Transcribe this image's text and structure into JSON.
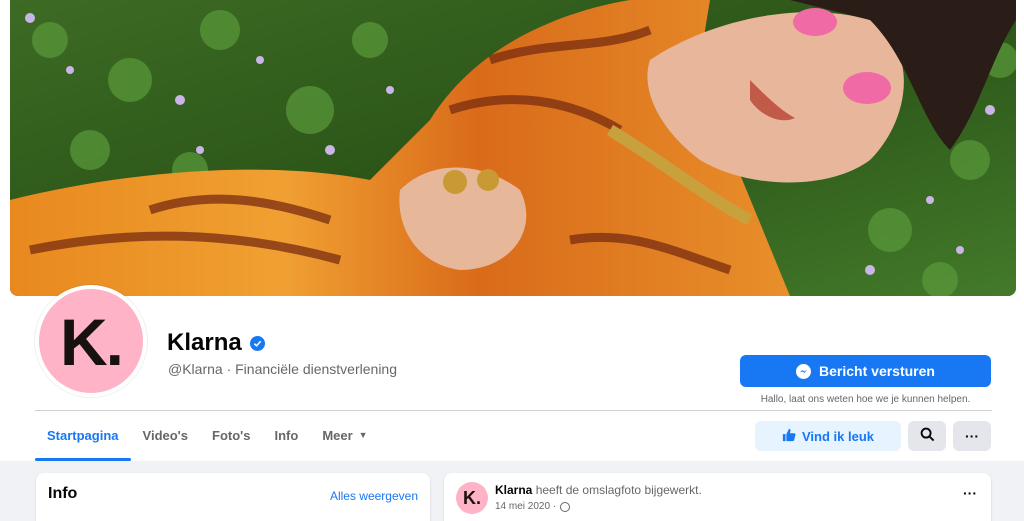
{
  "page": {
    "name": "Klarna",
    "subtitle": "@Klarna · Financiële dienstverlening",
    "avatar_mark": "K.",
    "verified_icon": "verified-badge-icon"
  },
  "actions": {
    "message_label": "Bericht versturen",
    "message_hint": "Hallo, laat ons weten hoe we je kunnen helpen.",
    "like_label": "Vind ik leuk",
    "search_icon": "search-icon",
    "more_icon": "more-dots-icon",
    "more_glyph": "···"
  },
  "tabs": [
    {
      "label": "Startpagina",
      "active": true
    },
    {
      "label": "Video's"
    },
    {
      "label": "Foto's"
    },
    {
      "label": "Info"
    },
    {
      "label": "Meer"
    }
  ],
  "info_card": {
    "title": "Info",
    "link": "Alles weergeven"
  },
  "post": {
    "author": "Klarna",
    "action": "heeft de omslagfoto bijgewerkt.",
    "date": "14 mei 2020 ·",
    "avatar_mark": "K."
  },
  "colors": {
    "accent": "#1877f2",
    "brand_pink": "#ffb3c7",
    "button_light": "#e7f3ff"
  }
}
